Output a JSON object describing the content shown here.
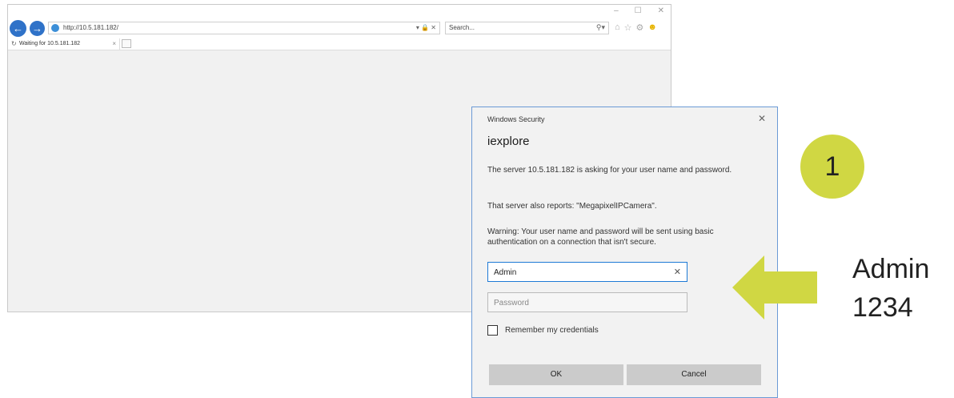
{
  "browser": {
    "window_controls": [
      "–",
      "☐",
      "✕"
    ],
    "address": "http://10.5.181.182/",
    "address_tools": "▾ 🔒 ✕",
    "search_placeholder": "Search...",
    "tab_title": "Waiting for 10.5.181.182",
    "tab_close": "×"
  },
  "dialog": {
    "caption": "Windows Security",
    "close": "✕",
    "title": "iexplore",
    "text1": "The server 10.5.181.182 is asking for your user name and password.",
    "text2": "That server also reports: \"MegapixelIPCamera\".",
    "text3": "Warning: Your user name and password will be sent using basic authentication on a connection that isn't secure.",
    "username_value": "Admin",
    "username_clear": "✕",
    "password_placeholder": "Password",
    "remember_label": "Remember my credentials",
    "ok_label": "OK",
    "cancel_label": "Cancel"
  },
  "annotation": {
    "step": "1",
    "username_hint": "Admin",
    "password_hint": "1234",
    "accent_color": "#d0d743"
  }
}
